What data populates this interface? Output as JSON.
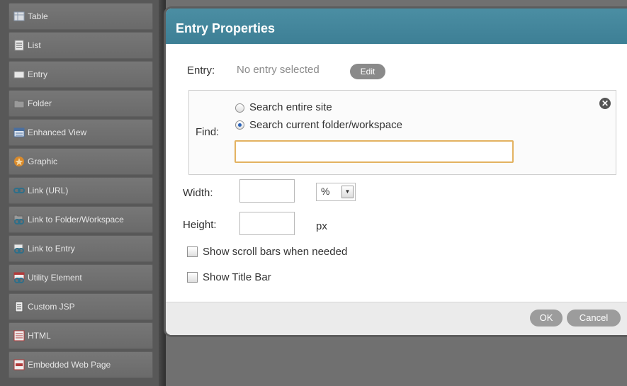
{
  "palette": {
    "items": [
      {
        "label": "Table",
        "icon": "table-icon"
      },
      {
        "label": "List",
        "icon": "list-icon"
      },
      {
        "label": "Entry",
        "icon": "entry-icon"
      },
      {
        "label": "Folder",
        "icon": "folder-icon"
      },
      {
        "label": "Enhanced View",
        "icon": "enhanced-view-icon"
      },
      {
        "label": "Graphic",
        "icon": "graphic-icon"
      },
      {
        "label": "Link (URL)",
        "icon": "link-icon"
      },
      {
        "label": "Link to Folder/Workspace",
        "icon": "link-folder-icon"
      },
      {
        "label": "Link to Entry",
        "icon": "link-entry-icon"
      },
      {
        "label": "Utility Element",
        "icon": "utility-icon"
      },
      {
        "label": "Custom JSP",
        "icon": "jsp-icon"
      },
      {
        "label": "HTML",
        "icon": "html-icon"
      },
      {
        "label": "Embedded Web Page",
        "icon": "web-page-icon"
      }
    ]
  },
  "dialog": {
    "title": "Entry Properties",
    "entry_label": "Entry:",
    "entry_value": "No entry selected",
    "edit_label": "Edit",
    "find_label": "Find:",
    "radio_site": "Search entire site",
    "radio_folder": "Search current folder/workspace",
    "search_value": "",
    "width_label": "Width:",
    "width_value": "",
    "width_unit": "%",
    "height_label": "Height:",
    "height_value": "",
    "height_unit": "px",
    "scrollbars_label": "Show scroll bars when needed",
    "titlebar_label": "Show Title Bar",
    "ok_label": "OK",
    "cancel_label": "Cancel"
  },
  "colors": {
    "header": "#4b8ea3",
    "search_border": "#e3b261",
    "button": "#9c9c9c"
  }
}
